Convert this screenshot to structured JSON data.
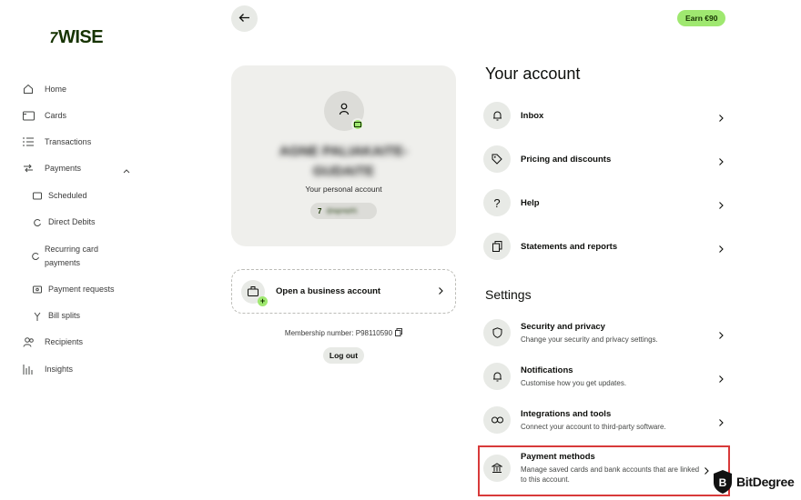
{
  "brand": {
    "logo_text": "WISE",
    "logo_mark": "7"
  },
  "sidebar": {
    "items": [
      {
        "label": "Home",
        "icon": "home-icon"
      },
      {
        "label": "Cards",
        "icon": "card-icon"
      },
      {
        "label": "Transactions",
        "icon": "list-icon"
      },
      {
        "label": "Payments",
        "icon": "payments-icon",
        "expanded": true
      },
      {
        "label": "Scheduled",
        "icon": "calendar-icon"
      },
      {
        "label": "Direct Debits",
        "icon": "refresh-icon"
      },
      {
        "label": "Recurring card payments",
        "icon": "recurring-icon"
      },
      {
        "label": "Payment requests",
        "icon": "request-icon"
      },
      {
        "label": "Bill splits",
        "icon": "split-icon"
      },
      {
        "label": "Recipients",
        "icon": "recipients-icon"
      },
      {
        "label": "Insights",
        "icon": "chart-icon"
      }
    ]
  },
  "header": {
    "earn_label": "Earn €90"
  },
  "profile": {
    "name": "AGNE PALIAKAITE-GUDAITE",
    "account_type": "Your personal account",
    "tag": "@agnep91"
  },
  "business": {
    "label": "Open a business account"
  },
  "membership": {
    "text": "Membership number: P98110590"
  },
  "logout_label": "Log out",
  "your_account": {
    "heading": "Your account",
    "items": [
      {
        "title": "Inbox",
        "icon": "bell-icon"
      },
      {
        "title": "Pricing and discounts",
        "icon": "tag-icon"
      },
      {
        "title": "Help",
        "icon": "help-icon"
      },
      {
        "title": "Statements and reports",
        "icon": "document-icon"
      }
    ]
  },
  "settings": {
    "heading": "Settings",
    "items": [
      {
        "title": "Security and privacy",
        "desc": "Change your security and privacy settings.",
        "icon": "shield-icon"
      },
      {
        "title": "Notifications",
        "desc": "Customise how you get updates.",
        "icon": "bell-icon"
      },
      {
        "title": "Integrations and tools",
        "desc": "Connect your account to third-party software.",
        "icon": "link-icon"
      },
      {
        "title": "Payment methods",
        "desc": "Manage saved cards and bank accounts that are linked to this account.",
        "icon": "bank-icon"
      }
    ]
  },
  "watermark": {
    "text": "BitDegree"
  },
  "colors": {
    "brand_green": "#163300",
    "accent_green": "#9fe870",
    "highlight_red": "#d83a3a"
  }
}
